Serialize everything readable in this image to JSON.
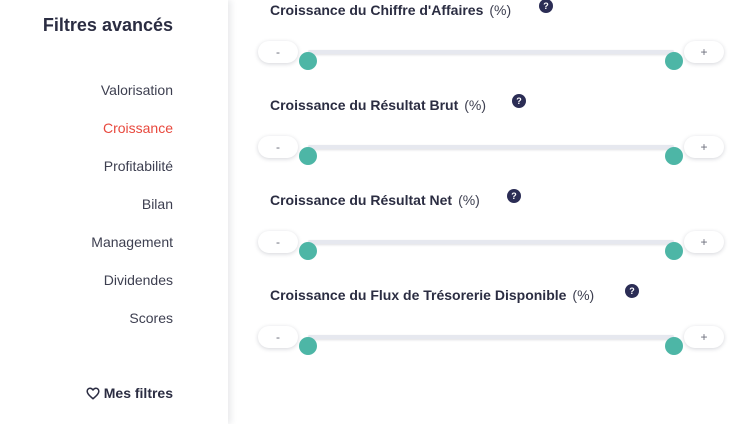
{
  "sidebar": {
    "title": "Filtres avancés",
    "items": [
      {
        "label": "Valorisation",
        "active": false
      },
      {
        "label": "Croissance",
        "active": true
      },
      {
        "label": "Profitabilité",
        "active": false
      },
      {
        "label": "Bilan",
        "active": false
      },
      {
        "label": "Management",
        "active": false
      },
      {
        "label": "Dividendes",
        "active": false
      },
      {
        "label": "Scores",
        "active": false
      }
    ],
    "my_filters_label": "Mes filtres",
    "my_filters_icon": "heart-icon"
  },
  "filters": [
    {
      "name": "Croissance du Chiffre d'Affaires",
      "unit": "(%)",
      "help": "?",
      "minus": "-",
      "plus": "+",
      "range_low": 0,
      "range_high": 1
    },
    {
      "name": "Croissance du Résultat Brut",
      "unit": "(%)",
      "help": "?",
      "minus": "-",
      "plus": "+",
      "range_low": 0,
      "range_high": 1
    },
    {
      "name": "Croissance du Résultat Net",
      "unit": "(%)",
      "help": "?",
      "minus": "-",
      "plus": "+",
      "range_low": 0,
      "range_high": 1
    },
    {
      "name": "Croissance du Flux de Trésorerie Disponible",
      "unit": "(%)",
      "help": "?",
      "minus": "-",
      "plus": "+",
      "range_low": 0,
      "range_high": 1
    }
  ],
  "colors": {
    "accent": "#4db6a6",
    "active_nav": "#e8493e",
    "text": "#2b2d42",
    "help_icon_bg": "#2b2d55"
  }
}
